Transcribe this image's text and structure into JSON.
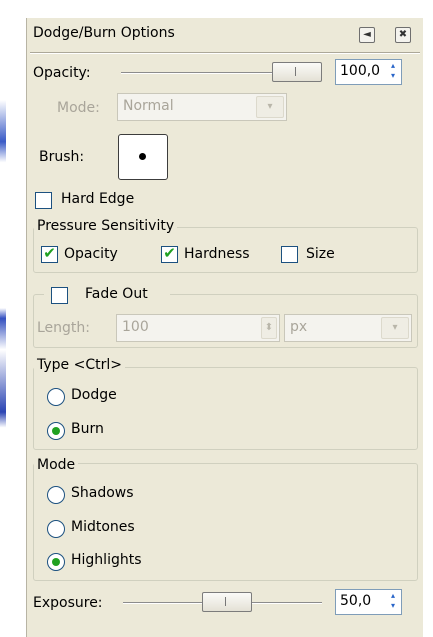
{
  "panel": {
    "title": "Dodge/Burn Options"
  },
  "icons": {
    "menu": "◄",
    "close": "✖",
    "check": "✔",
    "down": "▾",
    "up": "▴",
    "updown": "⬍"
  },
  "opacity": {
    "label": "Opacity:",
    "value": "100,0",
    "level_percent": 100
  },
  "mode_select": {
    "label": "Mode:",
    "value": "Normal"
  },
  "brush": {
    "label": "Brush:"
  },
  "hard_edge": {
    "label": "Hard Edge",
    "checked": false
  },
  "pressure": {
    "title": "Pressure Sensitivity",
    "items": [
      {
        "label": "Opacity",
        "checked": true
      },
      {
        "label": "Hardness",
        "checked": true
      },
      {
        "label": "Size",
        "checked": false
      }
    ]
  },
  "fade_out": {
    "label": "Fade Out",
    "checked": false,
    "length_label": "Length:",
    "length_value": "100",
    "unit": "px"
  },
  "type": {
    "title": "Type  <Ctrl>",
    "options": [
      {
        "label": "Dodge",
        "selected": false
      },
      {
        "label": "Burn",
        "selected": true
      }
    ]
  },
  "mode_group": {
    "title": "Mode",
    "options": [
      {
        "label": "Shadows",
        "selected": false
      },
      {
        "label": "Midtones",
        "selected": false
      },
      {
        "label": "Highlights",
        "selected": true
      }
    ]
  },
  "exposure": {
    "label": "Exposure:",
    "value": "50,0",
    "level_percent": 50
  },
  "colors": {
    "panel_bg": "#ece9d8",
    "check_green": "#21a121",
    "control_border": "#1c5180",
    "disabled_text": "#a9a59a"
  }
}
